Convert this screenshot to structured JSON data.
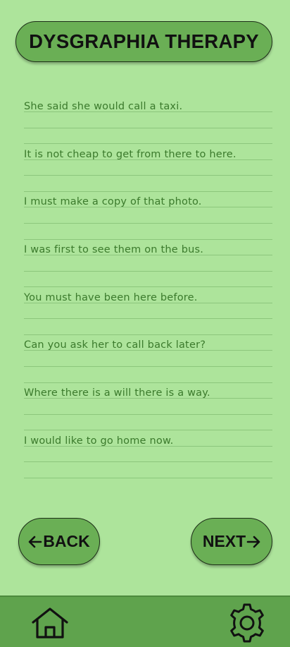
{
  "header": {
    "title": "DYSGRAPHIA THERAPY"
  },
  "sheet": {
    "sentences": [
      "She said she would call a taxi.",
      "It is not cheap to get from there to here.",
      "I must make a copy of that photo.",
      "I was first to see them on the bus.",
      "You must have been here before.",
      "Can you ask her to call back later?",
      "Where there is a will there is a way.",
      "I would like to go home now."
    ]
  },
  "navigation": {
    "back_label": "BACK",
    "next_label": "NEXT"
  },
  "bottom_bar": {
    "home_icon": "home-icon",
    "settings_icon": "gear-icon"
  },
  "colors": {
    "background": "#ade49b",
    "button": "#6aaf55",
    "bottom_bar": "#5fa34d",
    "sentence_text": "#3b7a2c",
    "rule": "#8cc67c"
  }
}
